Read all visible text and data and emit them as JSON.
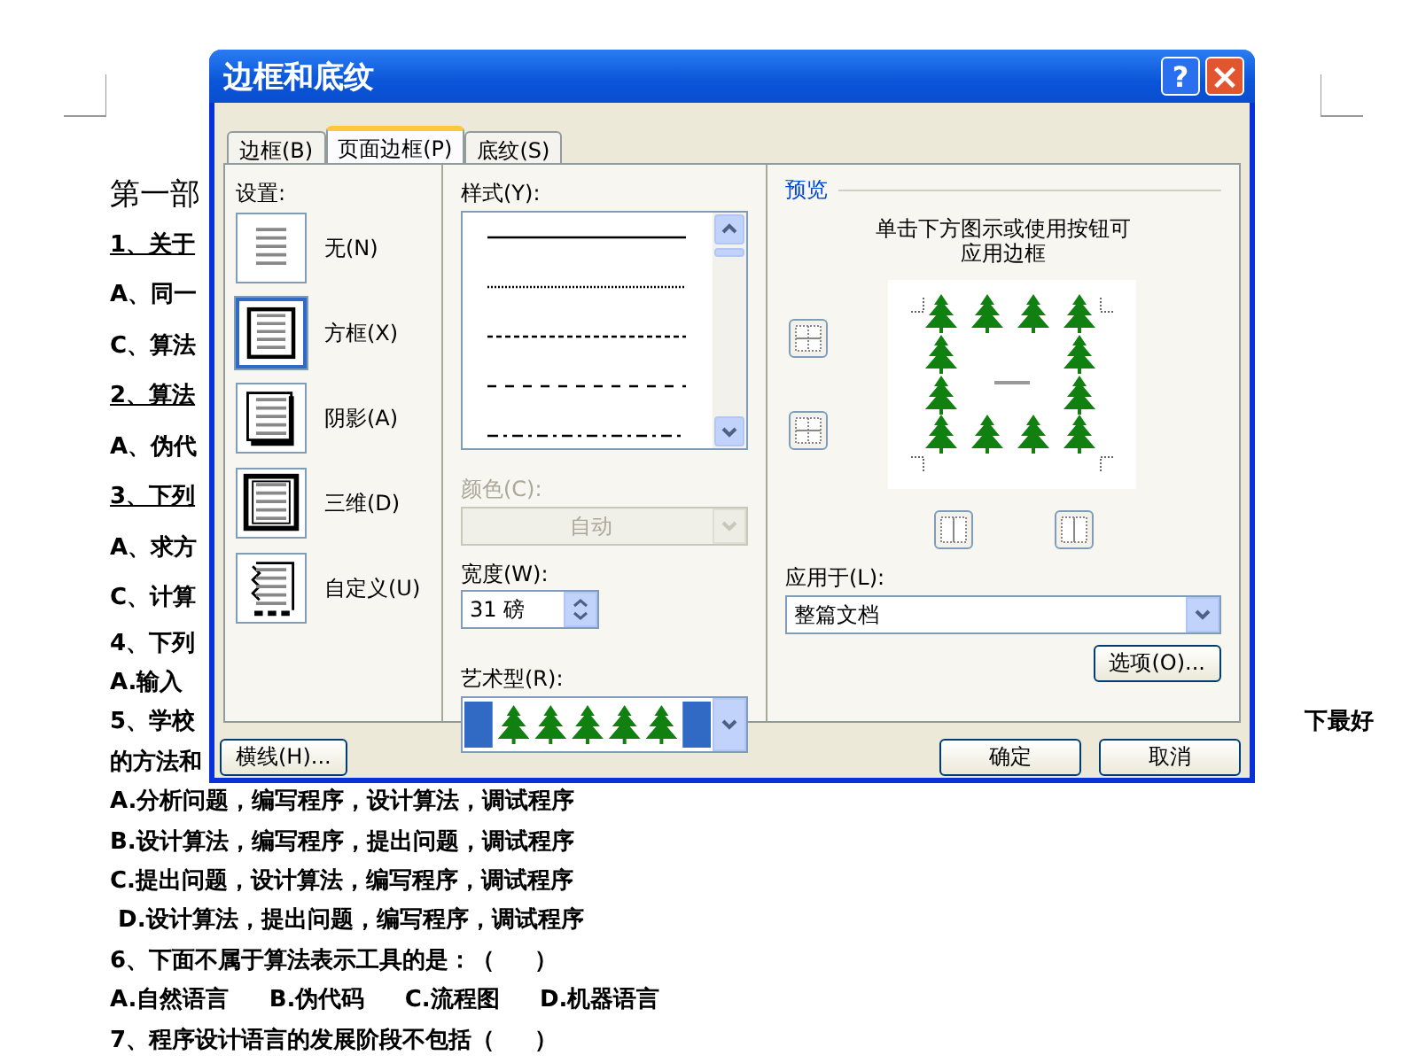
{
  "document": {
    "lines": [
      {
        "text": "第一部",
        "kind": "heading"
      },
      {
        "text": "1、关于",
        "kind": "underlined"
      },
      {
        "text": "A、同一",
        "kind": "plain"
      },
      {
        "text": "C、算法",
        "kind": "plain"
      },
      {
        "text": "2、算法",
        "kind": "underlined"
      },
      {
        "text": "A、伪代",
        "kind": "plain"
      },
      {
        "text": "3、下列",
        "kind": "underlined"
      },
      {
        "text": "A、求方",
        "kind": "plain"
      },
      {
        "text": "C、计算",
        "kind": "plain"
      },
      {
        "text": "4、下列",
        "kind": "plain"
      },
      {
        "text": "A.输入",
        "kind": "plain"
      },
      {
        "text": "5、学校",
        "kind": "plain",
        "tail": "下最好"
      },
      {
        "text": "的方法和",
        "kind": "plain"
      },
      {
        "text": "A.分析问题，编写程序，设计算法，调试程序",
        "kind": "plain"
      },
      {
        "text": "B.设计算法，编写程序，提出问题，调试程序",
        "kind": "plain"
      },
      {
        "text": "C.提出问题，设计算法，编写程序，调试程序",
        "kind": "plain"
      },
      {
        "text": " D.设计算法，提出问题，编写程序，调试程序",
        "kind": "plain"
      },
      {
        "text": "6、下面不属于算法表示工具的是：（     ）",
        "kind": "plain"
      },
      {
        "text": "A.自然语言     B.伪代码     C.流程图     D.机器语言",
        "kind": "plain"
      },
      {
        "text": "7、程序设计语言的发展阶段不包括（     ）",
        "kind": "plain"
      }
    ]
  },
  "dialog": {
    "title": "边框和底纹",
    "help_button": "?",
    "close_button": "×",
    "tabs": [
      {
        "label": "边框(B)",
        "selected": false
      },
      {
        "label": "页面边框(P)",
        "selected": true
      },
      {
        "label": "底纹(S)",
        "selected": false
      }
    ],
    "settings": {
      "label": "设置:",
      "items": [
        {
          "label": "无(N)",
          "kind": "none",
          "selected": false
        },
        {
          "label": "方框(X)",
          "kind": "box",
          "selected": true
        },
        {
          "label": "阴影(A)",
          "kind": "shadow",
          "selected": false
        },
        {
          "label": "三维(D)",
          "kind": "threed",
          "selected": false
        },
        {
          "label": "自定义(U)",
          "kind": "custom",
          "selected": false
        }
      ]
    },
    "style": {
      "label": "样式(Y):",
      "items": [
        {
          "kind": "solid"
        },
        {
          "kind": "dotted"
        },
        {
          "kind": "dashed"
        },
        {
          "kind": "longdash"
        },
        {
          "kind": "dashdot"
        }
      ]
    },
    "color": {
      "label": "颜色(C):",
      "value": "自动",
      "disabled": true
    },
    "width": {
      "label": "宽度(W):",
      "value": "31 磅"
    },
    "art": {
      "label": "艺术型(R):"
    },
    "preview": {
      "label": "预览",
      "hint": [
        "单击下方图示或使用按钮可",
        "应用边框"
      ]
    },
    "apply_to": {
      "label": "应用于(L):",
      "value": "整篇文档"
    },
    "options_button": "选项(O)...",
    "horizontal_line_button": "横线(H)...",
    "ok_button": "确定",
    "cancel_button": "取消"
  }
}
